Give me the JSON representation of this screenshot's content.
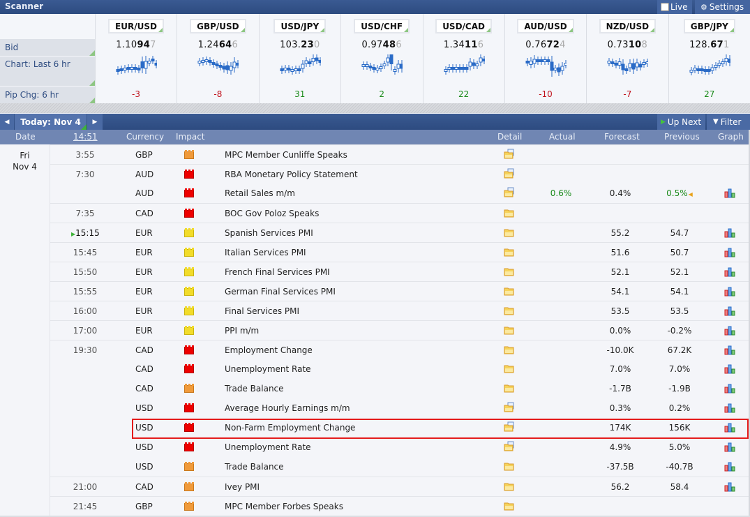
{
  "header": {
    "title": "Scanner",
    "live_label": "Live",
    "settings_label": "Settings"
  },
  "scanner": {
    "row_labels": {
      "bid": "Bid",
      "chart": "Chart: Last 6 hr",
      "pip": "Pip Chg: 6 hr"
    },
    "pairs": [
      {
        "name": "EUR/USD",
        "bid_main": "1.10",
        "bid_bold": "94",
        "bid_pip": "7",
        "pip_change": "-3",
        "direction": "neg"
      },
      {
        "name": "GBP/USD",
        "bid_main": "1.24",
        "bid_bold": "64",
        "bid_pip": "6",
        "pip_change": "-8",
        "direction": "neg"
      },
      {
        "name": "USD/JPY",
        "bid_main": "103.",
        "bid_bold": "23",
        "bid_pip": "0",
        "pip_change": "31",
        "direction": "pos"
      },
      {
        "name": "USD/CHF",
        "bid_main": "0.97",
        "bid_bold": "48",
        "bid_pip": "6",
        "pip_change": "2",
        "direction": "pos"
      },
      {
        "name": "USD/CAD",
        "bid_main": "1.34",
        "bid_bold": "11",
        "bid_pip": "6",
        "pip_change": "22",
        "direction": "pos"
      },
      {
        "name": "AUD/USD",
        "bid_main": "0.76",
        "bid_bold": "72",
        "bid_pip": "4",
        "pip_change": "-10",
        "direction": "neg"
      },
      {
        "name": "NZD/USD",
        "bid_main": "0.73",
        "bid_bold": "10",
        "bid_pip": "8",
        "pip_change": "-7",
        "direction": "neg"
      },
      {
        "name": "GBP/JPY",
        "bid_main": "128.",
        "bid_bold": "67",
        "bid_pip": "1",
        "pip_change": "27",
        "direction": "pos"
      }
    ]
  },
  "calendar": {
    "nav": {
      "prev_icon": "arrow-left-icon",
      "today_label": "Today: Nov 4",
      "next_icon": "arrow-right-icon",
      "up_next_label": "Up Next",
      "filter_label": "Filter"
    },
    "columns": {
      "date": "Date",
      "time": "14:51",
      "currency": "Currency",
      "impact": "Impact",
      "detail": "Detail",
      "actual": "Actual",
      "forecast": "Forecast",
      "previous": "Previous",
      "graph": "Graph"
    },
    "day": {
      "weekday": "Fri",
      "date": "Nov 4"
    },
    "colors": {
      "high": "#e00000",
      "medium": "#f09a3a",
      "low": "#f2dc2a",
      "better": "#1a8a1a",
      "highlight": "#e41b1b"
    },
    "events": [
      {
        "time": "3:55",
        "currency": "GBP",
        "impact": "orange",
        "event": "MPC Member Cunliffe Speaks",
        "detail": "doc",
        "actual": "",
        "forecast": "",
        "previous": "",
        "graph": false,
        "sep": true
      },
      {
        "time": "7:30",
        "currency": "AUD",
        "impact": "red",
        "event": "RBA Monetary Policy Statement",
        "detail": "doc",
        "actual": "",
        "forecast": "",
        "previous": "",
        "graph": false,
        "sep": true
      },
      {
        "time": "",
        "currency": "AUD",
        "impact": "red",
        "event": "Retail Sales m/m",
        "detail": "doc",
        "actual": "0.6%",
        "forecast": "0.4%",
        "previous": "0.5%",
        "previous_revised": true,
        "graph": true,
        "sep": false
      },
      {
        "time": "7:35",
        "currency": "CAD",
        "impact": "red",
        "event": "BOC Gov Poloz Speaks",
        "detail": "folder",
        "actual": "",
        "forecast": "",
        "previous": "",
        "graph": false,
        "sep": true
      },
      {
        "time": "15:15",
        "currency": "EUR",
        "impact": "yellow",
        "event": "Spanish Services PMI",
        "detail": "folder",
        "actual": "",
        "forecast": "55.2",
        "previous": "54.7",
        "graph": true,
        "sep": true,
        "up_next": true
      },
      {
        "time": "15:45",
        "currency": "EUR",
        "impact": "yellow",
        "event": "Italian Services PMI",
        "detail": "folder",
        "actual": "",
        "forecast": "51.6",
        "previous": "50.7",
        "graph": true,
        "sep": true
      },
      {
        "time": "15:50",
        "currency": "EUR",
        "impact": "yellow",
        "event": "French Final Services PMI",
        "detail": "folder",
        "actual": "",
        "forecast": "52.1",
        "previous": "52.1",
        "graph": true,
        "sep": true
      },
      {
        "time": "15:55",
        "currency": "EUR",
        "impact": "yellow",
        "event": "German Final Services PMI",
        "detail": "folder",
        "actual": "",
        "forecast": "54.1",
        "previous": "54.1",
        "graph": true,
        "sep": true
      },
      {
        "time": "16:00",
        "currency": "EUR",
        "impact": "yellow",
        "event": "Final Services PMI",
        "detail": "folder",
        "actual": "",
        "forecast": "53.5",
        "previous": "53.5",
        "graph": true,
        "sep": true
      },
      {
        "time": "17:00",
        "currency": "EUR",
        "impact": "yellow",
        "event": "PPI m/m",
        "detail": "folder",
        "actual": "",
        "forecast": "0.0%",
        "previous": "-0.2%",
        "graph": true,
        "sep": true
      },
      {
        "time": "19:30",
        "currency": "CAD",
        "impact": "red",
        "event": "Employment Change",
        "detail": "folder",
        "actual": "",
        "forecast": "-10.0K",
        "previous": "67.2K",
        "graph": true,
        "sep": true
      },
      {
        "time": "",
        "currency": "CAD",
        "impact": "red",
        "event": "Unemployment Rate",
        "detail": "folder",
        "actual": "",
        "forecast": "7.0%",
        "previous": "7.0%",
        "graph": true,
        "sep": false
      },
      {
        "time": "",
        "currency": "CAD",
        "impact": "orange",
        "event": "Trade Balance",
        "detail": "folder",
        "actual": "",
        "forecast": "-1.7B",
        "previous": "-1.9B",
        "graph": true,
        "sep": false
      },
      {
        "time": "",
        "currency": "USD",
        "impact": "red",
        "event": "Average Hourly Earnings m/m",
        "detail": "doc",
        "actual": "",
        "forecast": "0.3%",
        "previous": "0.2%",
        "graph": true,
        "sep": false
      },
      {
        "time": "",
        "currency": "USD",
        "impact": "red",
        "event": "Non-Farm Employment Change",
        "detail": "doc",
        "actual": "",
        "forecast": "174K",
        "previous": "156K",
        "graph": true,
        "sep": false,
        "highlighted": true
      },
      {
        "time": "",
        "currency": "USD",
        "impact": "red",
        "event": "Unemployment Rate",
        "detail": "doc",
        "actual": "",
        "forecast": "4.9%",
        "previous": "5.0%",
        "graph": true,
        "sep": false
      },
      {
        "time": "",
        "currency": "USD",
        "impact": "orange",
        "event": "Trade Balance",
        "detail": "folder",
        "actual": "",
        "forecast": "-37.5B",
        "previous": "-40.7B",
        "graph": true,
        "sep": false
      },
      {
        "time": "21:00",
        "currency": "CAD",
        "impact": "orange",
        "event": "Ivey PMI",
        "detail": "folder",
        "actual": "",
        "forecast": "56.2",
        "previous": "58.4",
        "graph": true,
        "sep": true
      },
      {
        "time": "21:45",
        "currency": "GBP",
        "impact": "orange",
        "event": "MPC Member Forbes Speaks",
        "detail": "folder",
        "actual": "",
        "forecast": "",
        "previous": "",
        "graph": false,
        "sep": true
      }
    ]
  }
}
